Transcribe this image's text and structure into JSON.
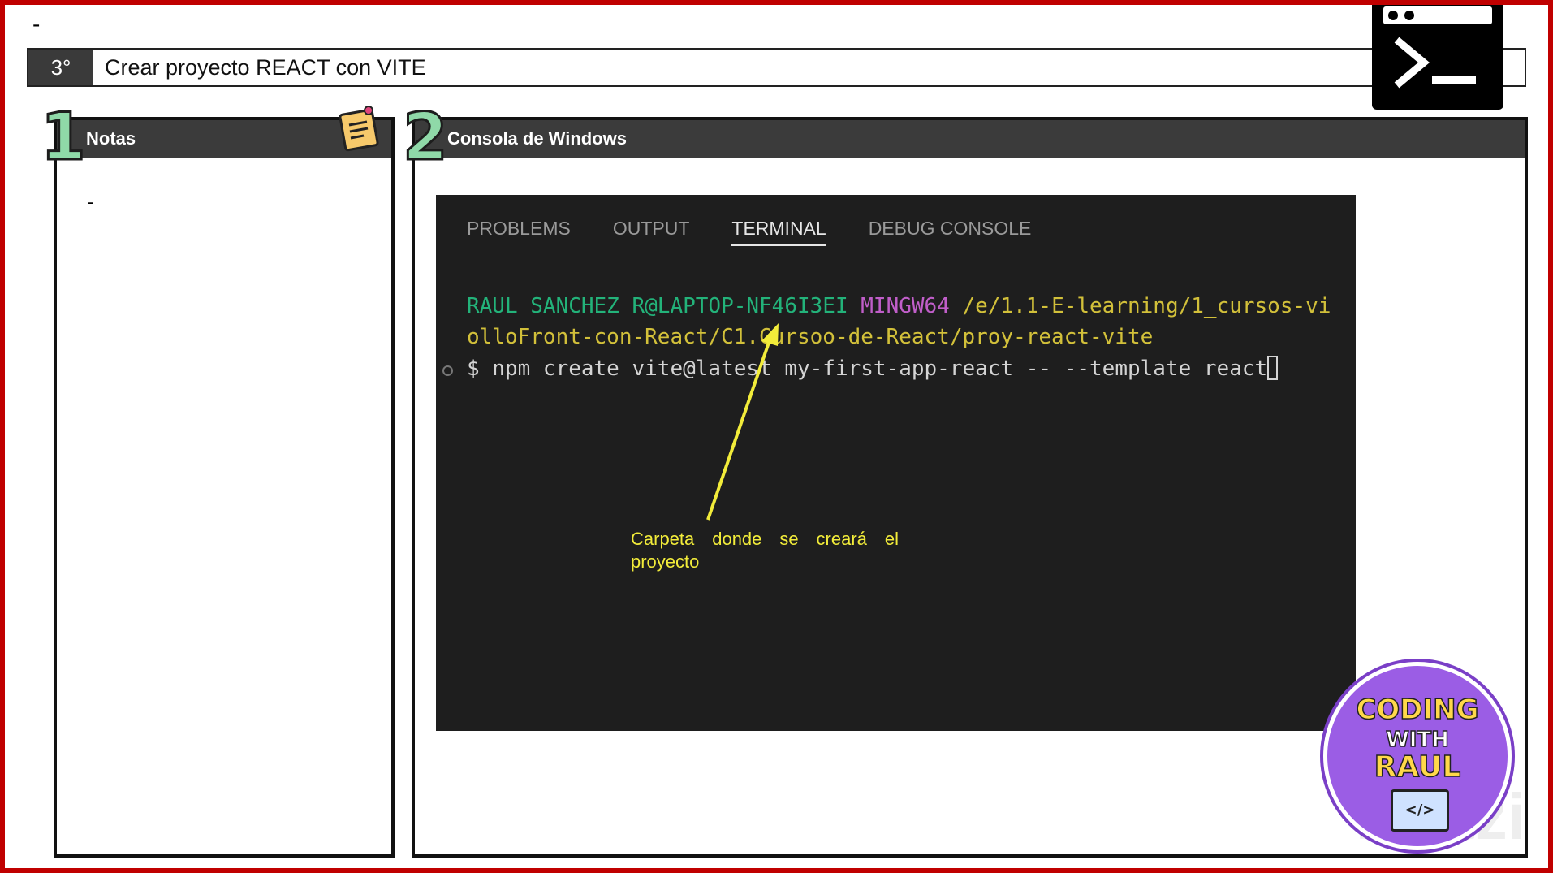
{
  "top_dash": "-",
  "step": {
    "number": "3°",
    "title": "Crear proyecto REACT con VITE"
  },
  "notes_panel": {
    "index": "1",
    "title": "Notas",
    "content": "-"
  },
  "console_panel": {
    "index": "2",
    "title": "Consola de Windows"
  },
  "terminal": {
    "tabs": [
      "PROBLEMS",
      "OUTPUT",
      "TERMINAL",
      "DEBUG CONSOLE"
    ],
    "active_tab": "TERMINAL",
    "prompt_user": "RAUL SANCHEZ R@LAPTOP-NF46I3EI",
    "prompt_env": "MINGW64",
    "prompt_path_1": "/e/1.1-E-learning/1_cursos-vi",
    "prompt_path_2": "olloFront-con-React/C1.Cursoo-de-React/proy-react-vite",
    "command": "$ npm create vite@latest my-first-app-react -- --template react"
  },
  "annotation": "Carpeta donde se creará el proyecto",
  "badge": {
    "line1": "CODING",
    "line2": "WITH",
    "line3": "RAUL",
    "code_glyph": "</>"
  },
  "watermark": "Platzi",
  "colors": {
    "frame": "#c00000",
    "header_bg": "#3b3b3b",
    "terminal_bg": "#1e1e1e",
    "prompt_green": "#23b37a",
    "prompt_magenta": "#c05ec9",
    "prompt_yellow": "#d2c03a",
    "annotation_yellow": "#f2ec3a",
    "step_number_green": "#8fd9a8"
  },
  "icons": [
    "terminal-window-icon",
    "sticky-note-icon",
    "arrow-annotation-icon",
    "coding-with-raul-logo"
  ]
}
